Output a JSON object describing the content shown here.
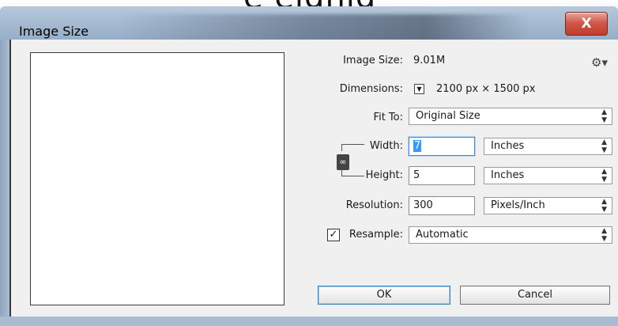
{
  "window": {
    "title": "Image Size",
    "close_label": "X"
  },
  "info": {
    "image_size_label": "Image Size:",
    "image_size_value": "9.01M",
    "dimensions_label": "Dimensions:",
    "dimensions_value": "2100 px  ×  1500 px"
  },
  "fit_to": {
    "label": "Fit To:",
    "value": "Original Size"
  },
  "width": {
    "label": "Width:",
    "value": "7",
    "unit": "Inches"
  },
  "height": {
    "label": "Height:",
    "value": "5",
    "unit": "Inches"
  },
  "resolution": {
    "label": "Resolution:",
    "value": "300",
    "unit": "Pixels/Inch"
  },
  "resample": {
    "label": "Resample:",
    "checked": true,
    "value": "Automatic"
  },
  "buttons": {
    "ok": "OK",
    "cancel": "Cancel"
  },
  "background_text": "e eighlg"
}
